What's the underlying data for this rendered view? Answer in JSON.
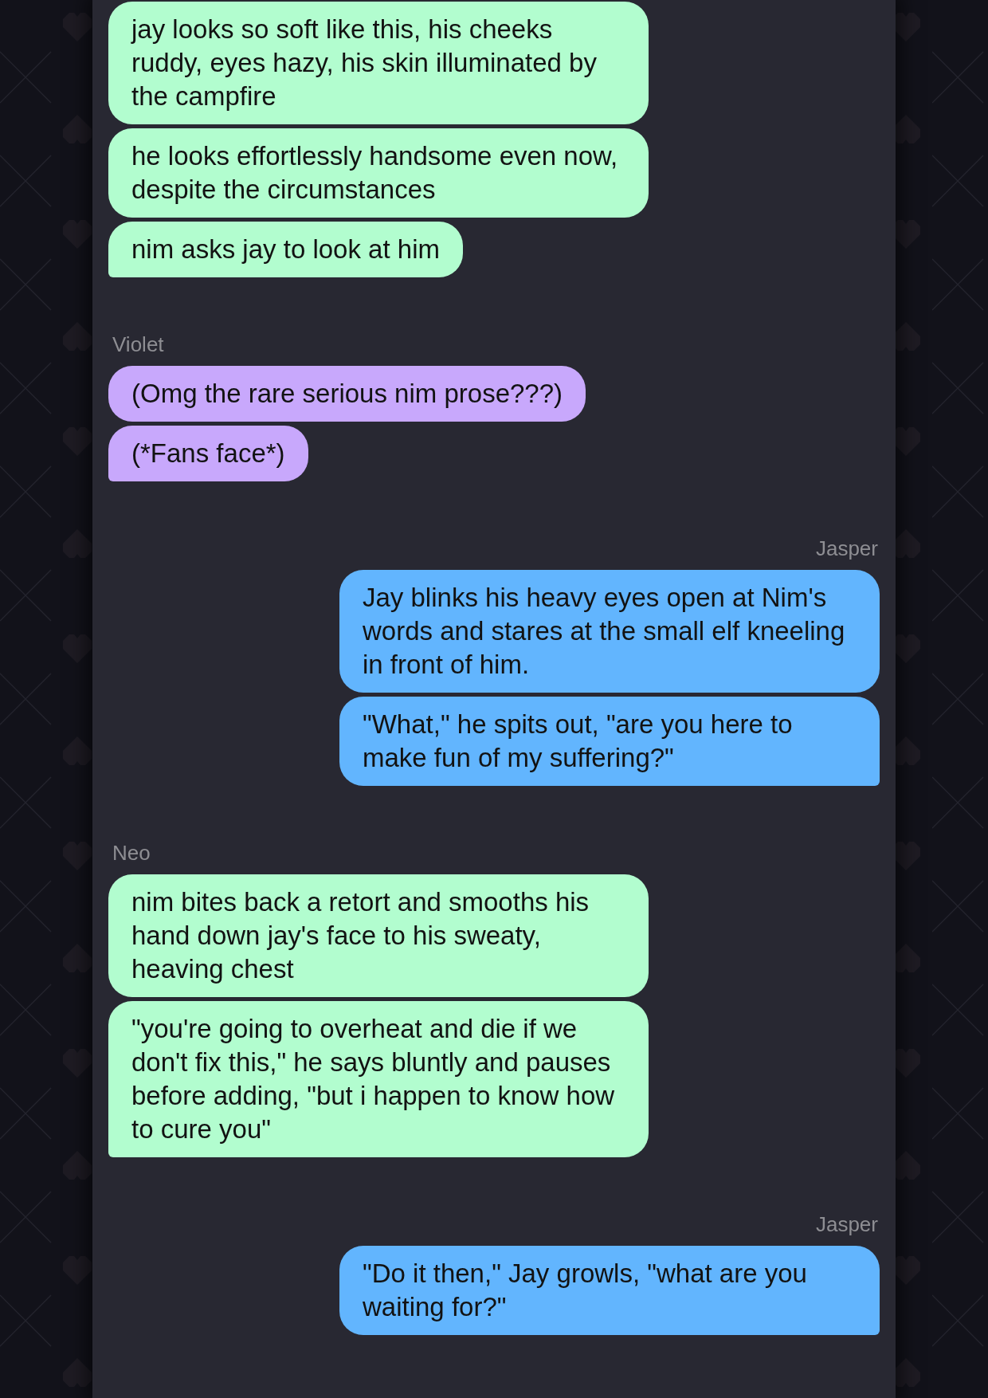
{
  "groups": [
    {
      "kind": "received",
      "color": "#b2fdcf",
      "messages": [
        "jay looks so soft like this, his cheeks ruddy, eyes hazy, his skin illuminated by the campfire",
        "he looks effortlessly handsome even now, despite the circumstances",
        "nim asks jay to look at him"
      ]
    },
    {
      "kind": "received",
      "sender": "Violet",
      "color": "#c8a8fc",
      "messages": [
        "(Omg the rare serious nim prose???)",
        "(*Fans face*)"
      ]
    },
    {
      "kind": "sent",
      "sender": "Jasper",
      "color": "#62b5fe",
      "messages": [
        "Jay blinks his heavy eyes open at Nim's words and stares at the small elf kneeling in front of him.",
        "\"What,\" he spits out, \"are you here to make fun of my suffering?\""
      ]
    },
    {
      "kind": "received",
      "sender": "Neo",
      "color": "#b2fdcf",
      "messages": [
        "nim bites back a retort and smooths his hand down jay's face to his sweaty, heaving chest",
        "\"you're going to overheat and die if we don't fix this,\" he says bluntly and pauses before adding, \"but i happen to know how to cure you\""
      ]
    },
    {
      "kind": "sent",
      "sender": "Jasper",
      "color": "#62b5fe",
      "messages": [
        "\"Do it then,\" Jay growls, \"what are you waiting for?\""
      ]
    }
  ]
}
